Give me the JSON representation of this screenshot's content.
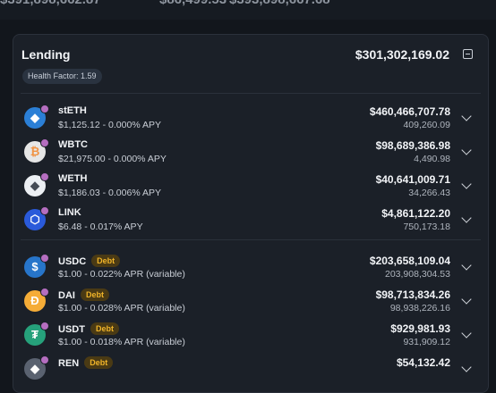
{
  "topbar": [
    "$391,898,662.87",
    "$86,499.53",
    "$393,898,667.68"
  ],
  "lending": {
    "title": "Lending",
    "total": "$301,302,169.02",
    "health_factor_label": "Health Factor:",
    "health_factor_value": "1.59"
  },
  "supplies": [
    {
      "name": "stETH",
      "rate": "$1,125.12 - 0.000% APY",
      "usd": "$460,466,707.78",
      "amount": "409,260.09",
      "icon": "steth-icon",
      "color": "#2b7fd6",
      "glyph": "◆"
    },
    {
      "name": "WBTC",
      "rate": "$21,975.00 - 0.000% APY",
      "usd": "$98,689,386.98",
      "amount": "4,490.98",
      "icon": "wbtc-icon",
      "color": "#e6e6e6",
      "glyph": "₿"
    },
    {
      "name": "WETH",
      "rate": "$1,186.03 - 0.006% APY",
      "usd": "$40,641,009.71",
      "amount": "34,266.43",
      "icon": "weth-icon",
      "color": "#eceff3",
      "glyph": "◆"
    },
    {
      "name": "LINK",
      "rate": "$6.48 - 0.017% APY",
      "usd": "$4,861,122.20",
      "amount": "750,173.18",
      "icon": "link-icon",
      "color": "#2a5ada",
      "glyph": "⬡"
    }
  ],
  "borrows": [
    {
      "name": "USDC",
      "badge": "Debt",
      "rate": "$1.00 - 0.022% APR (variable)",
      "usd": "$203,658,109.04",
      "amount": "203,908,304.53",
      "icon": "usdc-icon",
      "color": "#2775ca",
      "glyph": "$"
    },
    {
      "name": "DAI",
      "badge": "Debt",
      "rate": "$1.00 - 0.028% APR (variable)",
      "usd": "$98,713,834.26",
      "amount": "98,938,226.16",
      "icon": "dai-icon",
      "color": "#f5ac37",
      "glyph": "Ð"
    },
    {
      "name": "USDT",
      "badge": "Debt",
      "rate": "$1.00 - 0.018% APR (variable)",
      "usd": "$929,981.93",
      "amount": "931,909.12",
      "icon": "usdt-icon",
      "color": "#26a17b",
      "glyph": "₮"
    },
    {
      "name": "REN",
      "badge": "Debt",
      "rate": "",
      "usd": "$54,132.42",
      "amount": "",
      "icon": "ren-icon",
      "color": "#5a6270",
      "glyph": "◆"
    }
  ]
}
